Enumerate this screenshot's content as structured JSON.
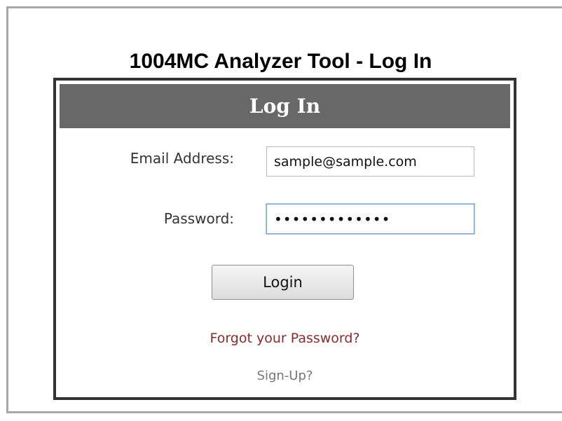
{
  "page": {
    "title": "1004MC Analyzer Tool - Log In"
  },
  "login_box": {
    "header": "Log In",
    "email_label": "Email Address:",
    "email_value": "sample@sample.com",
    "password_label": "Password:",
    "password_value": "•••••••••••••",
    "login_button": "Login",
    "forgot_link": "Forgot your Password?",
    "signup_link": "Sign-Up?"
  },
  "colors": {
    "header_bg": "#686868",
    "box_border": "#333333",
    "forgot_link": "#8b2a2a",
    "signup_link": "#777777",
    "focus_border": "#7aa7d6"
  }
}
